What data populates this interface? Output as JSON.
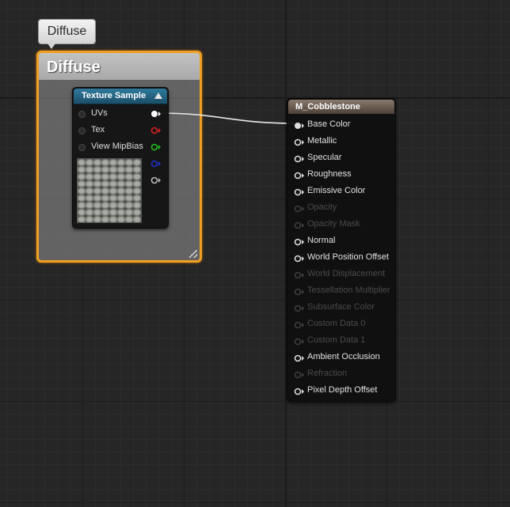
{
  "comment": {
    "bubble_text": "Diffuse",
    "title": "Diffuse",
    "color": "#f0a020"
  },
  "texture_node": {
    "title": "Texture Sample",
    "header_color": "#2f7a9c",
    "inputs": [
      "UVs",
      "Tex",
      "View MipBias"
    ],
    "outputs": [
      {
        "channel": "RGB",
        "color": "#ffffff",
        "connected": true
      },
      {
        "channel": "R",
        "color": "#e02020",
        "connected": false
      },
      {
        "channel": "G",
        "color": "#20c020",
        "connected": false
      },
      {
        "channel": "B",
        "color": "#2030d0",
        "connected": false
      },
      {
        "channel": "A",
        "color": "#bbbbbb",
        "connected": false
      }
    ],
    "preview": "cobblestone-texture-thumbnail"
  },
  "material_node": {
    "title": "M_Cobblestone",
    "header_color": "#8b7a6b",
    "inputs": [
      {
        "label": "Base Color",
        "enabled": true,
        "connected": true
      },
      {
        "label": "Metallic",
        "enabled": true,
        "connected": false
      },
      {
        "label": "Specular",
        "enabled": true,
        "connected": false
      },
      {
        "label": "Roughness",
        "enabled": true,
        "connected": false
      },
      {
        "label": "Emissive Color",
        "enabled": true,
        "connected": false
      },
      {
        "label": "Opacity",
        "enabled": false,
        "connected": false
      },
      {
        "label": "Opacity Mask",
        "enabled": false,
        "connected": false
      },
      {
        "label": "Normal",
        "enabled": true,
        "connected": false
      },
      {
        "label": "World Position Offset",
        "enabled": true,
        "connected": false
      },
      {
        "label": "World Displacement",
        "enabled": false,
        "connected": false
      },
      {
        "label": "Tessellation Multiplier",
        "enabled": false,
        "connected": false
      },
      {
        "label": "Subsurface Color",
        "enabled": false,
        "connected": false
      },
      {
        "label": "Custom Data 0",
        "enabled": false,
        "connected": false
      },
      {
        "label": "Custom Data 1",
        "enabled": false,
        "connected": false
      },
      {
        "label": "Ambient Occlusion",
        "enabled": true,
        "connected": false
      },
      {
        "label": "Refraction",
        "enabled": false,
        "connected": false
      },
      {
        "label": "Pixel Depth Offset",
        "enabled": true,
        "connected": false
      }
    ]
  },
  "connection": {
    "from": "texture_node.outputs.0",
    "to": "material_node.inputs.0"
  }
}
